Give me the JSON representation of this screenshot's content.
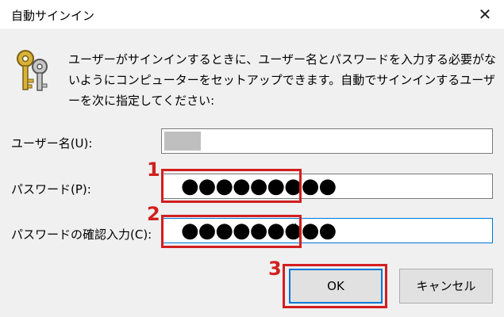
{
  "window": {
    "title": "自動サインイン",
    "close_glyph": "✕"
  },
  "description": "ユーザーがサインインするときに、ユーザー名とパスワードを入力する必要がないようにコンピューターをセットアップできます。自動でサインインするユーザーを次に指定してください:",
  "form": {
    "username_label": "ユーザー名(U):",
    "password_label": "パスワード(P):",
    "password_value": "●●●●●●●●●",
    "confirm_label": "パスワードの確認入力(C):",
    "confirm_value": "●●●●●●●●●"
  },
  "buttons": {
    "ok": "OK",
    "cancel": "キャンセル"
  },
  "annotations": {
    "step1": "1",
    "step2": "2",
    "step3": "3",
    "color": "#d21f1f"
  },
  "icons": {
    "keys": "keys-icon",
    "close": "close-icon"
  }
}
